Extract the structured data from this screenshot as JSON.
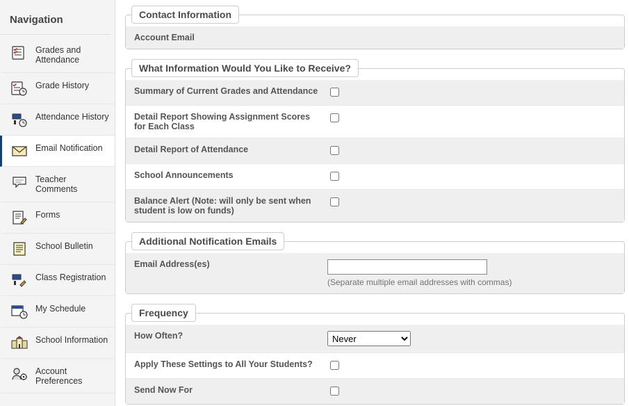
{
  "sidebar": {
    "title": "Navigation",
    "items": [
      {
        "label": "Grades and Attendance"
      },
      {
        "label": "Grade History"
      },
      {
        "label": "Attendance History"
      },
      {
        "label": "Email Notification"
      },
      {
        "label": "Teacher Comments"
      },
      {
        "label": "Forms"
      },
      {
        "label": "School Bulletin"
      },
      {
        "label": "Class Registration"
      },
      {
        "label": "My Schedule"
      },
      {
        "label": "School Information"
      },
      {
        "label": "Account Preferences"
      }
    ]
  },
  "sections": {
    "contact": {
      "legend": "Contact Information",
      "account_email_label": "Account Email"
    },
    "receive": {
      "legend": "What Information Would You Like to Receive?",
      "rows": {
        "summary": "Summary of Current Grades and Attendance",
        "detail_scores": "Detail Report Showing Assignment Scores for Each Class",
        "detail_attendance": "Detail Report of Attendance",
        "announcements": "School Announcements",
        "balance_alert": "Balance Alert (Note: will only be sent when student is low on funds)"
      }
    },
    "additional": {
      "legend": "Additional Notification Emails",
      "email_label": "Email Address(es)",
      "hint": "(Separate multiple email addresses with commas)"
    },
    "frequency": {
      "legend": "Frequency",
      "how_often_label": "How Often?",
      "how_often_value": "Never",
      "apply_all_label": "Apply These Settings to All Your Students?",
      "send_now_label": "Send Now For"
    }
  }
}
